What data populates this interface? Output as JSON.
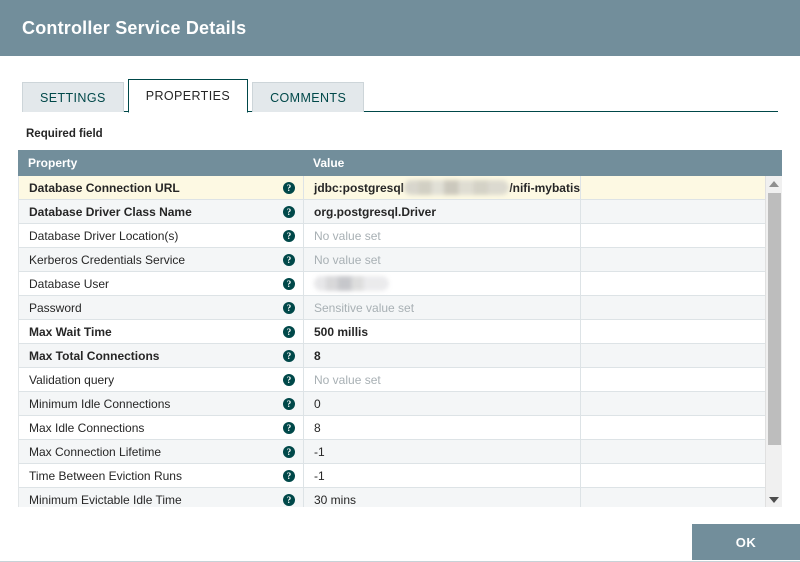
{
  "dialog": {
    "title": "Controller Service Details",
    "header_color": "#728e9b",
    "accent_color": "#004849"
  },
  "tabs": [
    {
      "label": "SETTINGS",
      "active": false
    },
    {
      "label": "PROPERTIES",
      "active": true
    },
    {
      "label": "COMMENTS",
      "active": false
    }
  ],
  "required_note": "Required field",
  "table": {
    "columns": {
      "property": "Property",
      "value": "Value"
    },
    "help_icon": "?",
    "rows": [
      {
        "property": "Database Connection URL",
        "value_prefix": "jdbc:postgresql",
        "redacted": true,
        "redact_width": 110,
        "value_suffix": "/nifi-mybatis",
        "required": true,
        "selected": true,
        "placeholder": false
      },
      {
        "property": "Database Driver Class Name",
        "value": "org.postgresql.Driver",
        "required": true,
        "selected": false,
        "placeholder": false
      },
      {
        "property": "Database Driver Location(s)",
        "value": "No value set",
        "required": false,
        "selected": false,
        "placeholder": true
      },
      {
        "property": "Kerberos Credentials Service",
        "value": "No value set",
        "required": false,
        "selected": false,
        "placeholder": true
      },
      {
        "property": "Database User",
        "value": "",
        "redacted": true,
        "redact_width": 75,
        "redact_style": "grey",
        "required": false,
        "selected": false,
        "placeholder": false
      },
      {
        "property": "Password",
        "value": "Sensitive value set",
        "required": false,
        "selected": false,
        "placeholder": true
      },
      {
        "property": "Max Wait Time",
        "value": "500 millis",
        "required": true,
        "selected": false,
        "placeholder": false
      },
      {
        "property": "Max Total Connections",
        "value": "8",
        "required": true,
        "selected": false,
        "placeholder": false
      },
      {
        "property": "Validation query",
        "value": "No value set",
        "required": false,
        "selected": false,
        "placeholder": true
      },
      {
        "property": "Minimum Idle Connections",
        "value": "0",
        "required": false,
        "selected": false,
        "placeholder": false
      },
      {
        "property": "Max Idle Connections",
        "value": "8",
        "required": false,
        "selected": false,
        "placeholder": false
      },
      {
        "property": "Max Connection Lifetime",
        "value": "-1",
        "required": false,
        "selected": false,
        "placeholder": false
      },
      {
        "property": "Time Between Eviction Runs",
        "value": "-1",
        "required": false,
        "selected": false,
        "placeholder": false
      },
      {
        "property": "Minimum Evictable Idle Time",
        "value": "30 mins",
        "required": false,
        "selected": false,
        "placeholder": false
      }
    ]
  },
  "footer": {
    "ok_label": "OK"
  }
}
